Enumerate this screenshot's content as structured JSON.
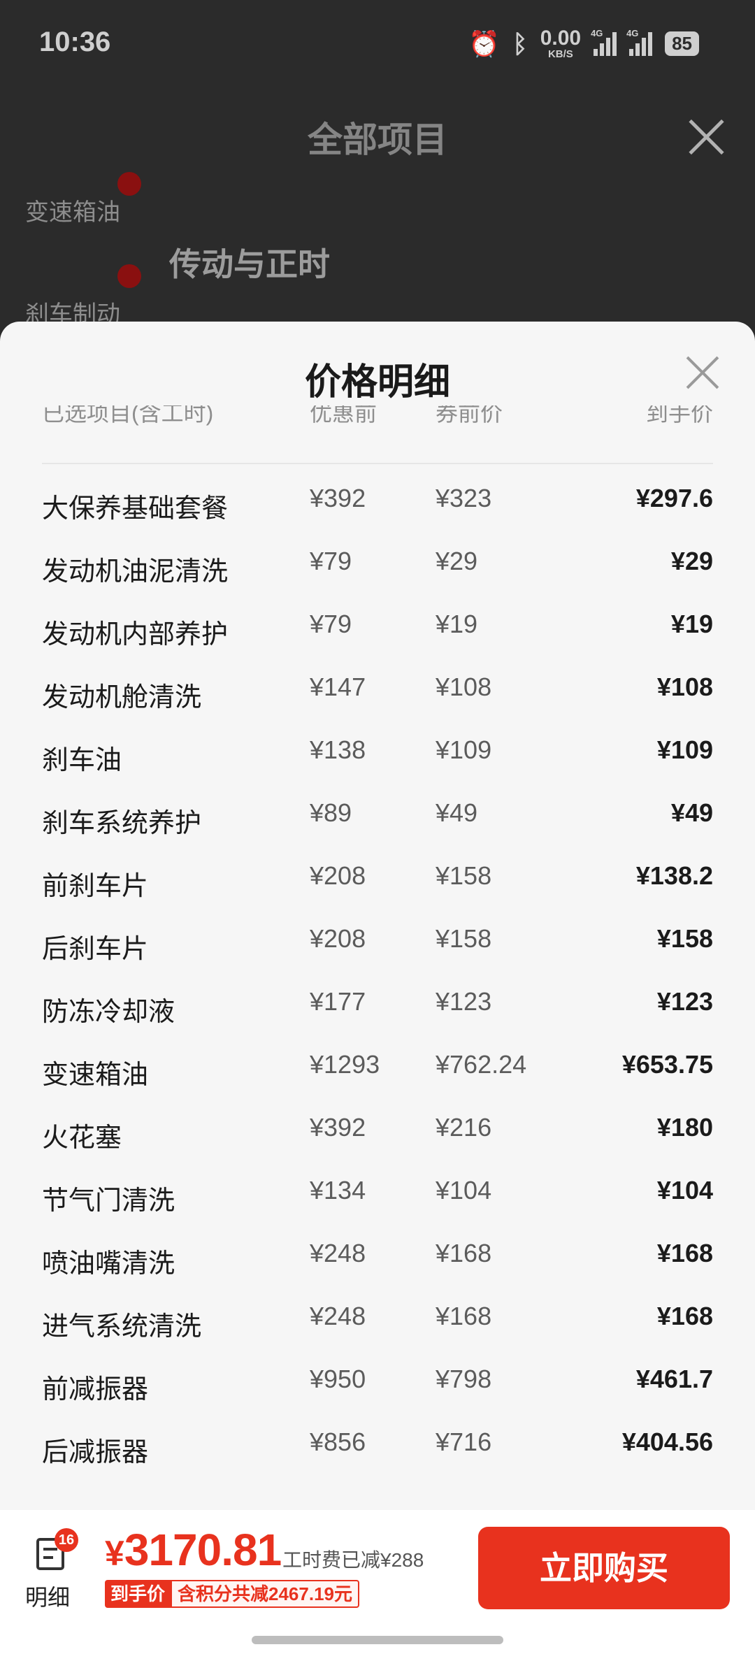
{
  "status_bar": {
    "time": "10:36",
    "net_speed": "0.00",
    "net_unit": "KB/S",
    "sim1": "4G",
    "sim2": "4G",
    "battery": "85"
  },
  "background": {
    "title": "全部项目",
    "side_items": [
      "变速箱油",
      "刹车制动"
    ],
    "section_title": "传动与正时"
  },
  "sheet": {
    "title": "价格明细",
    "columns": {
      "name": "已选项目(含工时)",
      "original": "优惠前",
      "coupon": "券前价",
      "final": "到手价"
    },
    "rows": [
      {
        "name": "大保养基础套餐",
        "original": "¥392",
        "coupon": "¥323",
        "final": "¥297.6"
      },
      {
        "name": "发动机油泥清洗",
        "original": "¥79",
        "coupon": "¥29",
        "final": "¥29"
      },
      {
        "name": "发动机内部养护",
        "original": "¥79",
        "coupon": "¥19",
        "final": "¥19"
      },
      {
        "name": "发动机舱清洗",
        "original": "¥147",
        "coupon": "¥108",
        "final": "¥108"
      },
      {
        "name": "刹车油",
        "original": "¥138",
        "coupon": "¥109",
        "final": "¥109"
      },
      {
        "name": "刹车系统养护",
        "original": "¥89",
        "coupon": "¥49",
        "final": "¥49"
      },
      {
        "name": "前刹车片",
        "original": "¥208",
        "coupon": "¥158",
        "final": "¥138.2"
      },
      {
        "name": "后刹车片",
        "original": "¥208",
        "coupon": "¥158",
        "final": "¥158"
      },
      {
        "name": "防冻冷却液",
        "original": "¥177",
        "coupon": "¥123",
        "final": "¥123"
      },
      {
        "name": "变速箱油",
        "original": "¥1293",
        "coupon": "¥762.24",
        "final": "¥653.75"
      },
      {
        "name": "火花塞",
        "original": "¥392",
        "coupon": "¥216",
        "final": "¥180"
      },
      {
        "name": "节气门清洗",
        "original": "¥134",
        "coupon": "¥104",
        "final": "¥104"
      },
      {
        "name": "喷油嘴清洗",
        "original": "¥248",
        "coupon": "¥168",
        "final": "¥168"
      },
      {
        "name": "进气系统清洗",
        "original": "¥248",
        "coupon": "¥168",
        "final": "¥168"
      },
      {
        "name": "前减振器",
        "original": "¥950",
        "coupon": "¥798",
        "final": "¥461.7"
      },
      {
        "name": "后减振器",
        "original": "¥856",
        "coupon": "¥716",
        "final": "¥404.56"
      }
    ]
  },
  "footer": {
    "detail_badge": "16",
    "detail_label": "明细",
    "currency": "¥",
    "total": "3170.81",
    "labor_note": "工时费已减¥288",
    "tag_label": "到手价",
    "tag_detail": "含积分共减2467.19元",
    "buy_label": "立即购买"
  },
  "colors": {
    "accent": "#e8321e",
    "sheet_bg": "#f6f6f6",
    "backdrop": "#2b2b2b"
  }
}
